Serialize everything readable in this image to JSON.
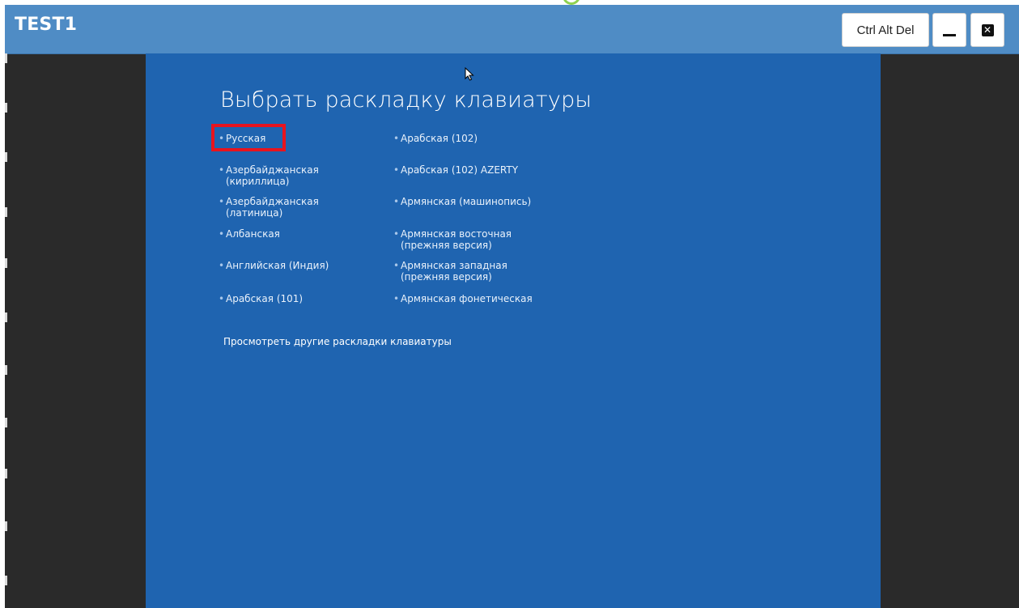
{
  "window": {
    "title": "TEST1"
  },
  "toolbar": {
    "ctrl_alt_del_label": "Ctrl Alt Del",
    "minimize_icon": "minimize-icon",
    "close_icon": "close-icon"
  },
  "screen": {
    "heading": "Выбрать раскладку клавиатуры",
    "bullet": "•",
    "column1": [
      {
        "label": "Русская",
        "selected": true
      },
      {
        "label": "Азербайджанская",
        "label2": "(кириллица)"
      },
      {
        "label": "Азербайджанская",
        "label2": "(латиница)"
      },
      {
        "label": "Албанская"
      },
      {
        "label": "Английская (Индия)"
      },
      {
        "label": "Арабская (101)"
      }
    ],
    "column2": [
      {
        "label": "Арабская (102)"
      },
      {
        "label": "Арабская (102) AZERTY"
      },
      {
        "label": "Армянская (машинопись)"
      },
      {
        "label": "Армянская восточная",
        "label2": "(прежняя версия)"
      },
      {
        "label": "Армянская западная",
        "label2": "(прежняя версия)"
      },
      {
        "label": "Армянская фонетическая"
      }
    ],
    "more_link": "Просмотреть другие раскладки клавиатуры",
    "background_color": "#1f64b0",
    "highlight_color": "#e8141e"
  },
  "colors": {
    "titlebar": "#4f8cc5",
    "frame": "#2a2a2a"
  }
}
